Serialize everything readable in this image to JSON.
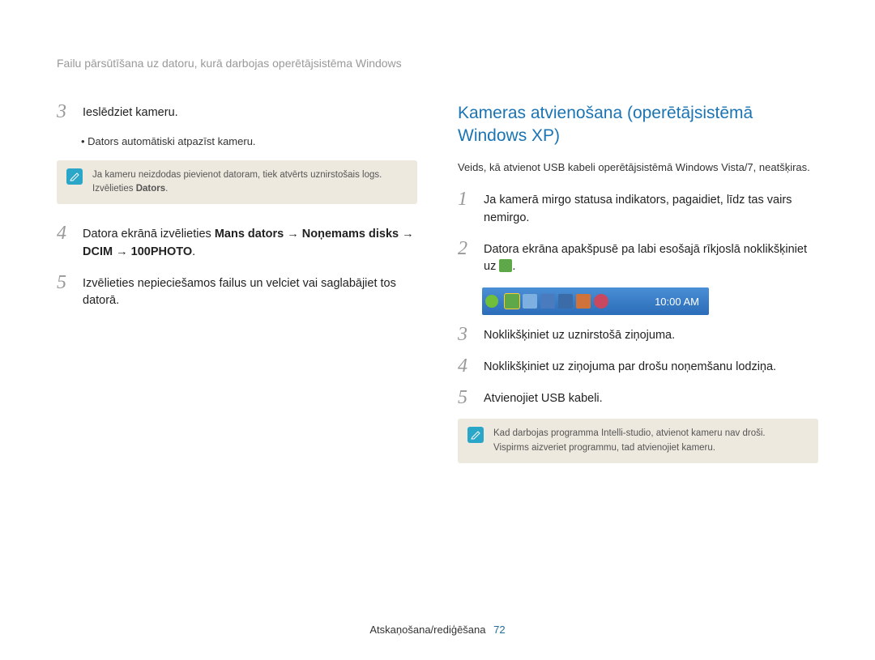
{
  "header": {
    "title": "Failu pārsūtīšana uz datoru, kurā darbojas operētājsistēma Windows"
  },
  "left": {
    "step3": {
      "num": "3",
      "text": "Ieslēdziet kameru."
    },
    "bullet1": "Dators automātiski atpazīst kameru.",
    "note1_line1": "Ja kameru neizdodas pievienot datoram, tiek atvērts uznirstošais logs.",
    "note1_line2_a": "Izvēlieties ",
    "note1_line2_b": "Dators",
    "note1_line2_c": ".",
    "step4": {
      "num": "4",
      "pre": "Datora ekrānā izvēlieties ",
      "b1": "Mans dators",
      "arr": " → ",
      "b2": "Noņemams disks",
      "b3": "DCIM",
      "b4": "100PHOTO",
      "post": "."
    },
    "step5": {
      "num": "5",
      "text": "Izvēlieties nepieciešamos failus un velciet vai saglabājiet tos datorā."
    }
  },
  "right": {
    "heading": "Kameras atvienošana (operētājsistēmā Windows XP)",
    "sub": "Veids, kā atvienot USB kabeli operētājsistēmā Windows Vista/7, neatšķiras.",
    "step1": {
      "num": "1",
      "text": "Ja kamerā mirgo statusa indikators, pagaidiet, līdz tas vairs nemirgo."
    },
    "step2": {
      "num": "2",
      "text_a": "Datora ekrāna apakšpusē pa labi esošajā rīkjoslā noklikšķiniet uz ",
      "text_b": "."
    },
    "taskbar": {
      "time": "10:00 AM"
    },
    "step3": {
      "num": "3",
      "text": "Noklikšķiniet uz uznirstošā ziņojuma."
    },
    "step4": {
      "num": "4",
      "text": "Noklikšķiniet uz ziņojuma par drošu noņemšanu lodziņa."
    },
    "step5": {
      "num": "5",
      "text": "Atvienojiet USB kabeli."
    },
    "note2_line1": "Kad darbojas programma Intelli-studio, atvienot kameru nav droši.",
    "note2_line2": "Vispirms aizveriet programmu, tad atvienojiet kameru."
  },
  "footer": {
    "section": "Atskaņošana/rediģēšana",
    "page": "72"
  }
}
